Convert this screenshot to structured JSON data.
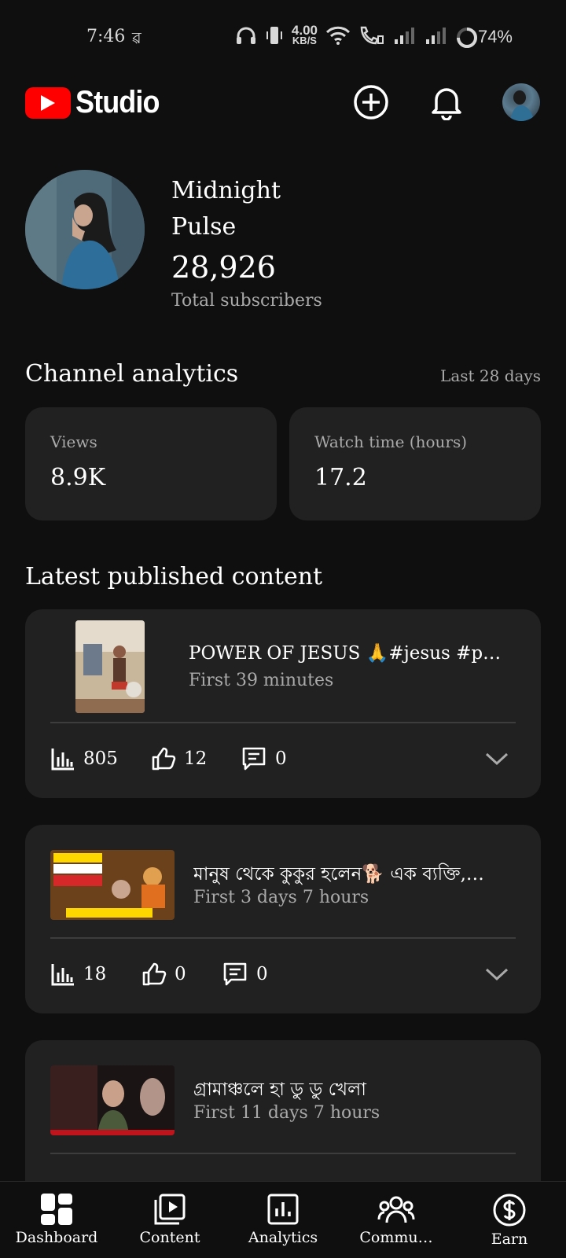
{
  "status_bar": {
    "time": "7:46",
    "net_speed_value": "4.00",
    "net_speed_unit": "KB/S",
    "battery": "74%"
  },
  "header": {
    "brand": "Studio"
  },
  "channel": {
    "name_line1": "Midnight",
    "name_line2": "Pulse",
    "subscribers": "28,926",
    "subscribers_label": "Total subscribers"
  },
  "analytics": {
    "title": "Channel analytics",
    "range": "Last 28 days",
    "cards": [
      {
        "label": "Views",
        "value": "8.9K"
      },
      {
        "label": "Watch time (hours)",
        "value": "17.2"
      }
    ]
  },
  "latest": {
    "title": "Latest published content",
    "items": [
      {
        "title": "POWER OF JESUS 🙏#jesus #powe…",
        "sub": "First 39 minutes",
        "views": "805",
        "likes": "12",
        "comments": "0"
      },
      {
        "title": "মানুষ থেকে কুকুর হলেন🐕 এক ব্যক্তি,…",
        "sub": "First 3 days 7 hours",
        "views": "18",
        "likes": "0",
        "comments": "0"
      },
      {
        "title": "গ্রামাঞ্চলে হা ডু ডু খেলা",
        "sub": "First 11 days 7 hours"
      }
    ]
  },
  "nav": {
    "items": [
      {
        "label": "Dashboard",
        "icon": "dashboard-icon"
      },
      {
        "label": "Content",
        "icon": "content-icon"
      },
      {
        "label": "Analytics",
        "icon": "analytics-icon"
      },
      {
        "label": "Commu…",
        "icon": "community-icon"
      },
      {
        "label": "Earn",
        "icon": "earn-icon"
      }
    ]
  }
}
